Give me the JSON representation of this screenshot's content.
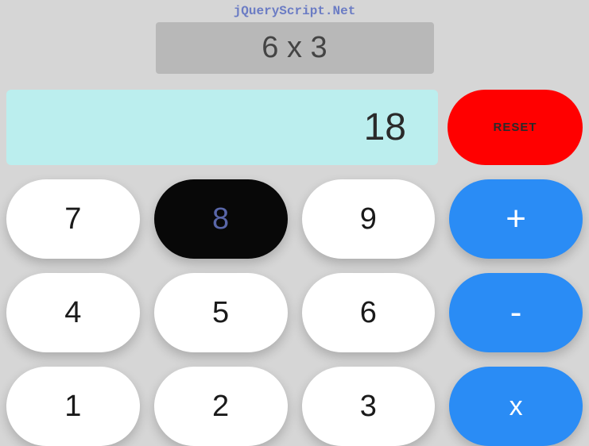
{
  "brand": "jQueryScript.Net",
  "expression": "6 x 3",
  "result": "18",
  "reset_label": "RESET",
  "buttons": {
    "row1": [
      "7",
      "8",
      "9",
      "+"
    ],
    "row2": [
      "4",
      "5",
      "6",
      "-"
    ],
    "row3": [
      "1",
      "2",
      "3",
      "x"
    ]
  },
  "active_button": "8"
}
